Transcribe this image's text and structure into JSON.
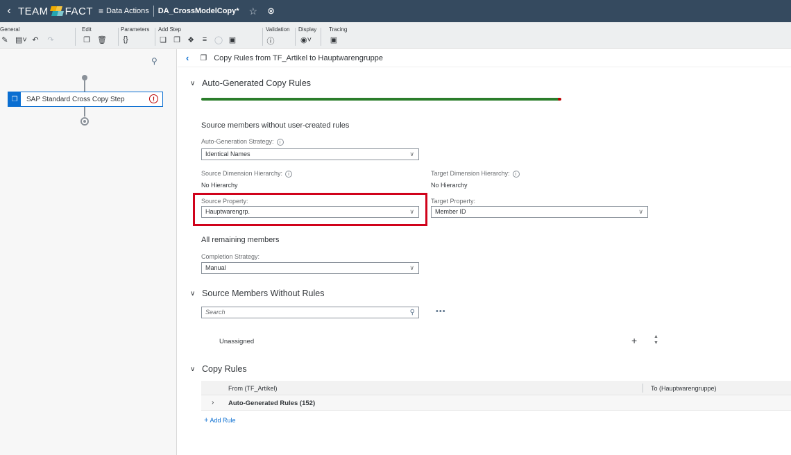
{
  "shell": {
    "back_icon": "chevron-left-icon",
    "logo_left": "TEAM",
    "logo_right": "FACT",
    "app_name": "Data Actions",
    "document_title": "DA_CrossModelCopy",
    "modified_marker": "*",
    "favorite_icon": "star-icon",
    "close_icon": "close-circle-icon",
    "colors": {
      "shell_bg": "#354a5f",
      "logo_orange": "#f0ab00",
      "logo_teal": "#25a6b0"
    }
  },
  "toolbar": {
    "groups": [
      {
        "label": "General",
        "icons": [
          "tools-icon",
          "save-dropdown-icon",
          "undo-icon",
          "redo-icon"
        ]
      },
      {
        "label": "Edit",
        "icons": [
          "copy-icon",
          "delete-icon"
        ]
      },
      {
        "label": "Parameters",
        "icons": [
          "braces-icon"
        ]
      },
      {
        "label": "Add Step",
        "icons": [
          "copy-step-icon",
          "cross-copy-step-icon",
          "allocation-step-icon",
          "advanced-formula-icon",
          "currency-icon",
          "script-icon"
        ]
      },
      {
        "label": "Validation",
        "icons": [
          "validation-icon"
        ]
      },
      {
        "label": "Display",
        "icons": [
          "display-dropdown-icon"
        ]
      },
      {
        "label": "Tracing",
        "icons": [
          "tracing-icon"
        ]
      }
    ]
  },
  "left_pane": {
    "search_icon": "search-icon",
    "step": {
      "label": "SAP Standard Cross Copy Step",
      "icon": "copy-step-icon",
      "status_icon": "error-icon"
    }
  },
  "main": {
    "header_title": "Copy Rules from TF_Artikel to Hauptwarengruppe",
    "auto_section": {
      "title": "Auto-Generated Copy Rules",
      "progress_fraction": 0.99,
      "subheading": "Source members without user-created rules",
      "strategy_label": "Auto-Generation Strategy:",
      "strategy_value": "Identical Names",
      "source_hier_label": "Source Dimension Hierarchy:",
      "source_hier_value": "No Hierarchy",
      "target_hier_label": "Target Dimension Hierarchy:",
      "target_hier_value": "No Hierarchy",
      "source_prop_label": "Source Property:",
      "source_prop_value": "Hauptwarengrp.",
      "target_prop_label": "Target Property:",
      "target_prop_value": "Member ID",
      "remaining_heading": "All remaining members",
      "completion_label": "Completion Strategy:",
      "completion_value": "Manual"
    },
    "source_members_section": {
      "title": "Source Members Without Rules",
      "search_placeholder": "Search",
      "more_label": "•••",
      "unassigned_label": "Unassigned",
      "plus_label": "+"
    },
    "copy_rules_section": {
      "title": "Copy Rules",
      "col_from": "From (TF_Artikel)",
      "col_to": "To (Hauptwarengruppe)",
      "row_label": "Auto-Generated Rules (152)",
      "add_rule_label": "Add Rule"
    }
  }
}
